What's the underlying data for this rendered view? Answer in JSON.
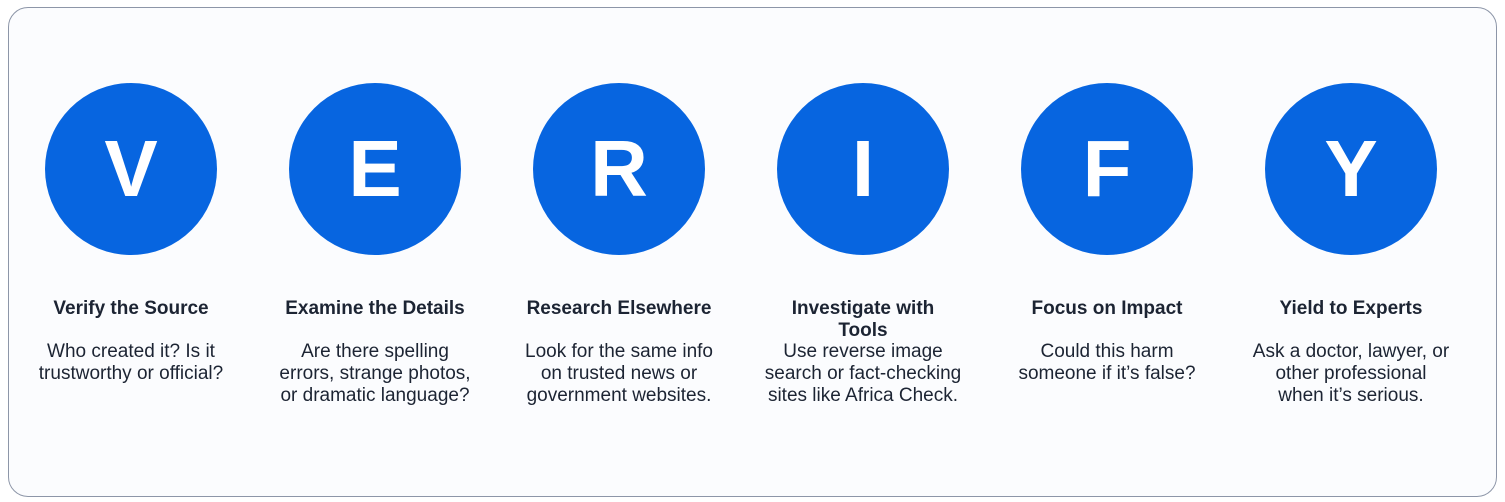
{
  "steps": [
    {
      "letter": "V",
      "title": "Verify the Source",
      "description": "Who created it? Is it trustworthy or official?"
    },
    {
      "letter": "E",
      "title": "Examine the Details",
      "description": "Are there spelling errors, strange photos, or dramatic language?"
    },
    {
      "letter": "R",
      "title": "Research Elsewhere",
      "description": "Look for the same info on trusted news or government websites."
    },
    {
      "letter": "I",
      "title": "Investigate with Tools",
      "description": "Use reverse image search or fact-checking sites like Africa Check."
    },
    {
      "letter": "F",
      "title": "Focus on Impact",
      "description": "Could this harm someone if it’s false?"
    },
    {
      "letter": "Y",
      "title": "Yield to Experts",
      "description": "Ask a doctor, lawyer, or other professional when it’s serious."
    }
  ],
  "colors": {
    "circle": "#0765e0",
    "text": "#1c2433",
    "border": "#8d96a8"
  }
}
